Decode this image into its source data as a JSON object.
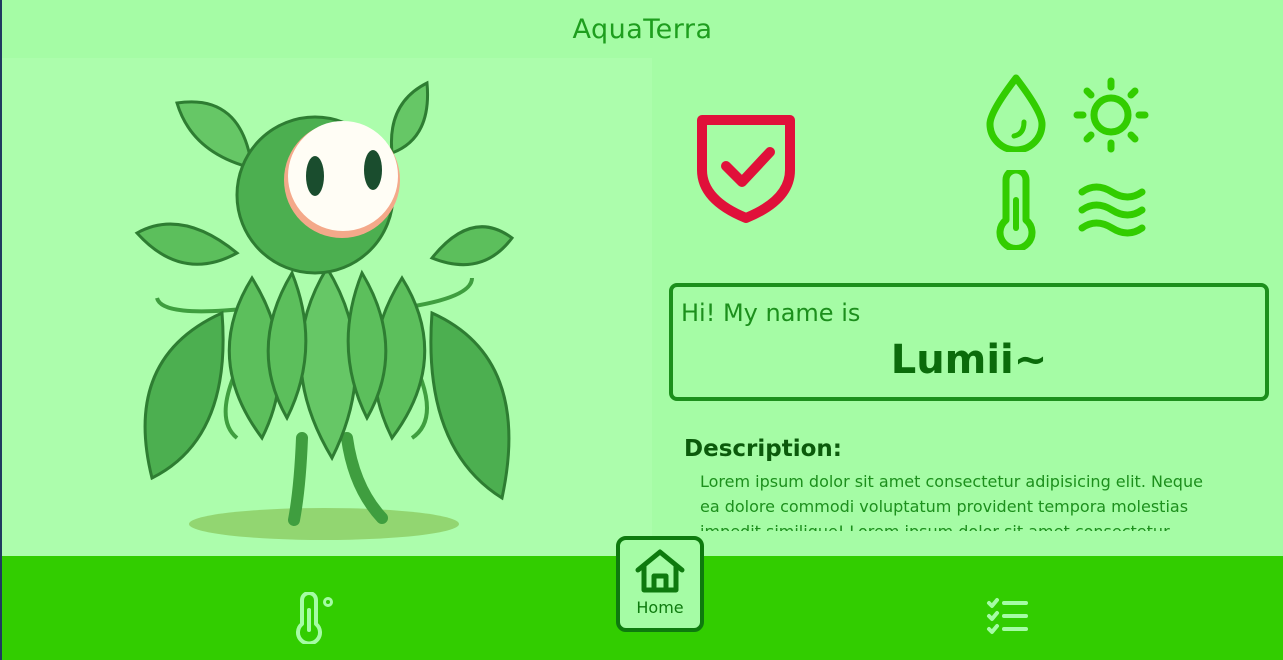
{
  "app": {
    "title": "AquaTerra"
  },
  "status": {
    "protection_icon": "shield-check-icon",
    "needs": [
      "water-drop-icon",
      "sun-icon",
      "thermometer-icon",
      "air-waves-icon"
    ]
  },
  "pet": {
    "greeting": "Hi! My name is",
    "name": "Lumii~"
  },
  "description": {
    "title": "Description:",
    "text": "Lorem ipsum dolor sit amet consectetur adipisicing elit. Neque ea dolore commodi voluptatum provident tempora molestias impedit similique! Lorem ipsum dolor sit amet consectetur"
  },
  "nav": {
    "items": [
      {
        "icon": "thermometer-icon",
        "label": ""
      },
      {
        "icon": "home-icon",
        "label": "Home"
      },
      {
        "icon": "checklist-icon",
        "label": ""
      }
    ]
  },
  "colors": {
    "background": "#a5fca5",
    "accent": "#32cd00",
    "dark_green": "#0b6b0b",
    "shield_red": "#e0103a"
  }
}
